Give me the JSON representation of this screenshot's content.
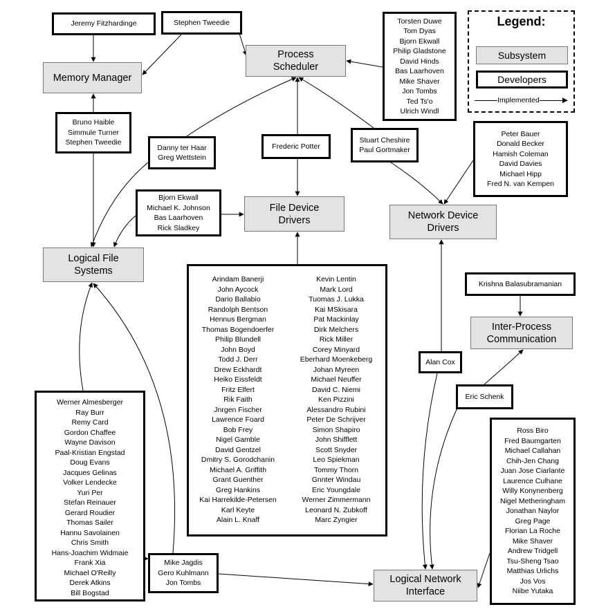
{
  "legend": {
    "title": "Legend:",
    "subsystem": "Subsystem",
    "developers": "Developers",
    "implemented": "Implemented"
  },
  "subsystems": {
    "memory_manager": "Memory Manager",
    "process_scheduler": "Process Scheduler",
    "file_device_drivers": "File Device Drivers",
    "network_device_drivers": "Network Device Drivers",
    "logical_file_systems": "Logical File Systems",
    "ipc": "Inter-Process Communication",
    "logical_network_interface": "Logical Network Interface"
  },
  "developers": {
    "jeremy": [
      "Jeremy Fitzhardinge"
    ],
    "tweedie": [
      "Stephen Tweedie"
    ],
    "scheduler": [
      "Torsten Duwe",
      "Tom Dyas",
      "Bjorn Ekwall",
      "Philip Gladstone",
      "David Hinds",
      "Bas Laarhoven",
      "Mike Shaver",
      "Jon Tombs",
      "Ted Ts'o",
      "Ulrich Windl"
    ],
    "bruno": [
      "Bruno Haible",
      "Simmule Turner",
      "Stephen Tweedie"
    ],
    "danny": [
      "Danny ter Haar",
      "Greg Wettstein"
    ],
    "frederic": [
      "Frederic Potter"
    ],
    "stuart": [
      "Stuart Cheshire",
      "Paul Gortmaker"
    ],
    "netdev": [
      "Peter Bauer",
      "Donald Becker",
      "Hamish Coleman",
      "David Davies",
      "Michael Hipp",
      "Fred N. van Kempen"
    ],
    "bjorn": [
      "Bjorn Ekwall",
      "Michael K. Johnson",
      "Bas Laarhoven",
      "Rick Sladkey"
    ],
    "filedev_left": [
      "Arindam Banerji",
      "John Aycock",
      "Dario Ballabio",
      "Randolph Bentson",
      "Hennus Bergman",
      "Thomas Bogendoerfer",
      "Philip Blundell",
      "John Boyd",
      "Todd J. Derr",
      "Drew Eckhardt",
      "Heiko Eissfeldt",
      "Fritz Elfert",
      "Rik Faith",
      "Jnrgen Fischer",
      "Lawrence Foard",
      "Bob Frey",
      "Nigel Gamble",
      "David Gentzel",
      "Dmitry S. Gorodchanin",
      "Michael A. Griffith",
      "Grant Guenther",
      "Greg Hankins",
      "Kai Harrekilde-Petersen",
      "Karl Keyte",
      "Alain L. Knaff"
    ],
    "filedev_right": [
      "Kevin Lentin",
      "Mark Lord",
      "Tuomas J. Lukka",
      "Kai MSkisara",
      "Pat Mackinlay",
      "Dirk Melchers",
      "Rick Miller",
      "Corey Minyard",
      "Eberhard Moenkeberg",
      "Johan Myreen",
      "Michael Neuffer",
      "David C. Niemi",
      "Ken Pizzini",
      "Alessandro Rubini",
      "Peter De Schrijver",
      "Simon Shapiro",
      "John Shifflett",
      "Scott Snyder",
      "Leo Spiekman",
      "Tommy Thorn",
      "Gnnter Windau",
      "Eric Youngdale",
      "Werner Zimmermann",
      "Leonard N. Zubkoff",
      "Marc Zyngier"
    ],
    "krishna": [
      "Krishna Balasubramanian"
    ],
    "alan": [
      "Alan Cox"
    ],
    "eric": [
      "Eric Schenk"
    ],
    "fs": [
      "Werner Almesberger",
      "Ray Burr",
      "Remy Card",
      "Gordon Chaffee",
      "Wayne Davison",
      "Paal-Kristian Engstad",
      "Doug Evans",
      "Jacques Gelinas",
      "Volker Lendecke",
      "Yuri Per",
      "Stefan Reinauer",
      "Gerard Roudier",
      "Thomas Sailer",
      "Hannu Savolainen",
      "Chris Smith",
      "Hans-Joachim Widmaie",
      "Frank Xia",
      "Michael O'Reilly",
      "Derek Atkins",
      "Bill Bogstad"
    ],
    "net": [
      "Ross Biro",
      "Fred Baumgarten",
      "Michael Callahan",
      "Chih-Jen Chang",
      "Juan Jose Ciarlante",
      "Laurence Culhane",
      "Willy Konynenberg",
      "Nigel Metheringham",
      "Jonathan Naylor",
      "Greg Page",
      "Florian La Roche",
      "Mike Shaver",
      "Andrew Tridgell",
      "Tsu-Sheng Tsao",
      "Matthias Urlichs",
      "Jos Vos",
      "Niibe Yutaka"
    ],
    "mike": [
      "Mike Jagdis",
      "Gero Kuhlmann",
      "Jon Tombs"
    ]
  },
  "colors": {
    "subsystem_fill": "#e3e3e3",
    "border": "#000000"
  }
}
